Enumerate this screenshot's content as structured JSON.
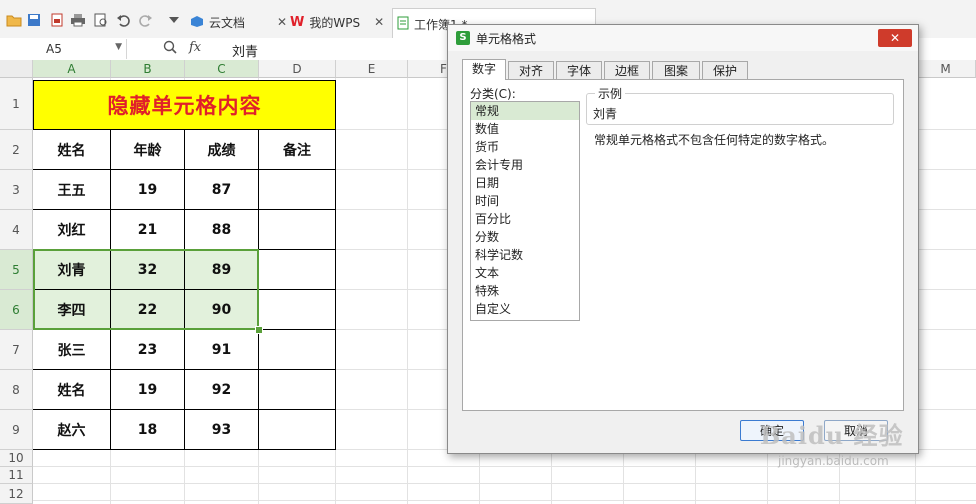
{
  "tabs": [
    {
      "label": "云文档",
      "closable": true
    },
    {
      "label": "我的WPS",
      "closable": true
    },
    {
      "label": "工作簿1 *",
      "closable": false
    }
  ],
  "formula_bar": {
    "cell_ref": "A5",
    "fx_label": "fx",
    "value": "刘青"
  },
  "columns": [
    "A",
    "B",
    "C",
    "D",
    "E",
    "F",
    "M"
  ],
  "rows": [
    "1",
    "2",
    "3",
    "4",
    "5",
    "6",
    "7",
    "8",
    "9",
    "10",
    "11",
    "12"
  ],
  "sheet": {
    "title": "隐藏单元格内容",
    "headers": [
      "姓名",
      "年龄",
      "成绩",
      "备注"
    ],
    "records": [
      {
        "name": "王五",
        "age": "19",
        "score": "87",
        "note": ""
      },
      {
        "name": "刘红",
        "age": "21",
        "score": "88",
        "note": ""
      },
      {
        "name": "刘青",
        "age": "32",
        "score": "89",
        "note": ""
      },
      {
        "name": "李四",
        "age": "22",
        "score": "90",
        "note": ""
      },
      {
        "name": "张三",
        "age": "23",
        "score": "91",
        "note": ""
      },
      {
        "name": "姓名",
        "age": "19",
        "score": "92",
        "note": ""
      },
      {
        "name": "赵六",
        "age": "18",
        "score": "93",
        "note": ""
      }
    ]
  },
  "dialog": {
    "title": "单元格格式",
    "close_label": "✕",
    "tabs": [
      "数字",
      "对齐",
      "字体",
      "边框",
      "图案",
      "保护"
    ],
    "category_label": "分类(C):",
    "categories": [
      "常规",
      "数值",
      "货币",
      "会计专用",
      "日期",
      "时间",
      "百分比",
      "分数",
      "科学记数",
      "文本",
      "特殊",
      "自定义"
    ],
    "selected_category": "常规",
    "sample_label": "示例",
    "sample_value": "刘青",
    "description": "常规单元格格式不包含任何特定的数字格式。",
    "ok_label": "确定",
    "cancel_label": "取消"
  },
  "watermark": {
    "brand": "Baidu 经验",
    "url": "jingyan.baidu.com"
  },
  "colors": {
    "title_fill": "#ffff00",
    "title_text": "#e0202a",
    "selection": "#5aa03a",
    "close_button": "#cf3b2b"
  }
}
